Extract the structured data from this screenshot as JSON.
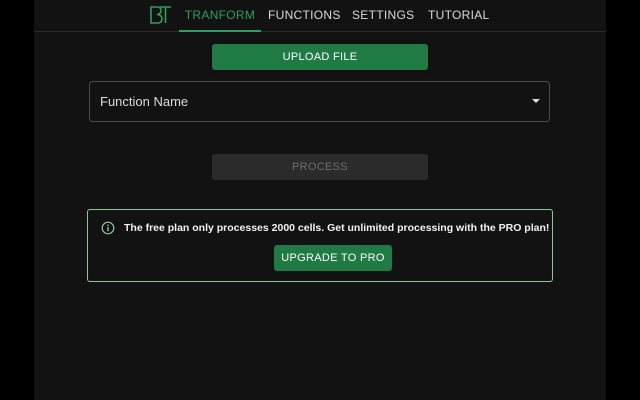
{
  "nav": {
    "logo_icon": "bt-logo-icon",
    "tabs": [
      {
        "label": "TRANFORM",
        "active": true
      },
      {
        "label": "FUNCTIONS",
        "active": false
      },
      {
        "label": "SETTINGS",
        "active": false
      },
      {
        "label": "TUTORIAL",
        "active": false
      }
    ]
  },
  "main": {
    "upload_label": "UPLOAD FILE",
    "function_select": {
      "value": "Function Name",
      "icon": "caret-down-icon"
    },
    "process_label": "PROCESS",
    "alert": {
      "icon": "info-icon",
      "message": "The free plan only processes 2000 cells. Get unlimited processing with the PRO plan!",
      "button_label": "UPGRADE TO PRO"
    }
  },
  "colors": {
    "accent": "#2e9e5a",
    "button_green": "#1f7a43",
    "alert_border": "#8cc79c",
    "panel_bg": "#121212",
    "page_bg": "#000000"
  }
}
